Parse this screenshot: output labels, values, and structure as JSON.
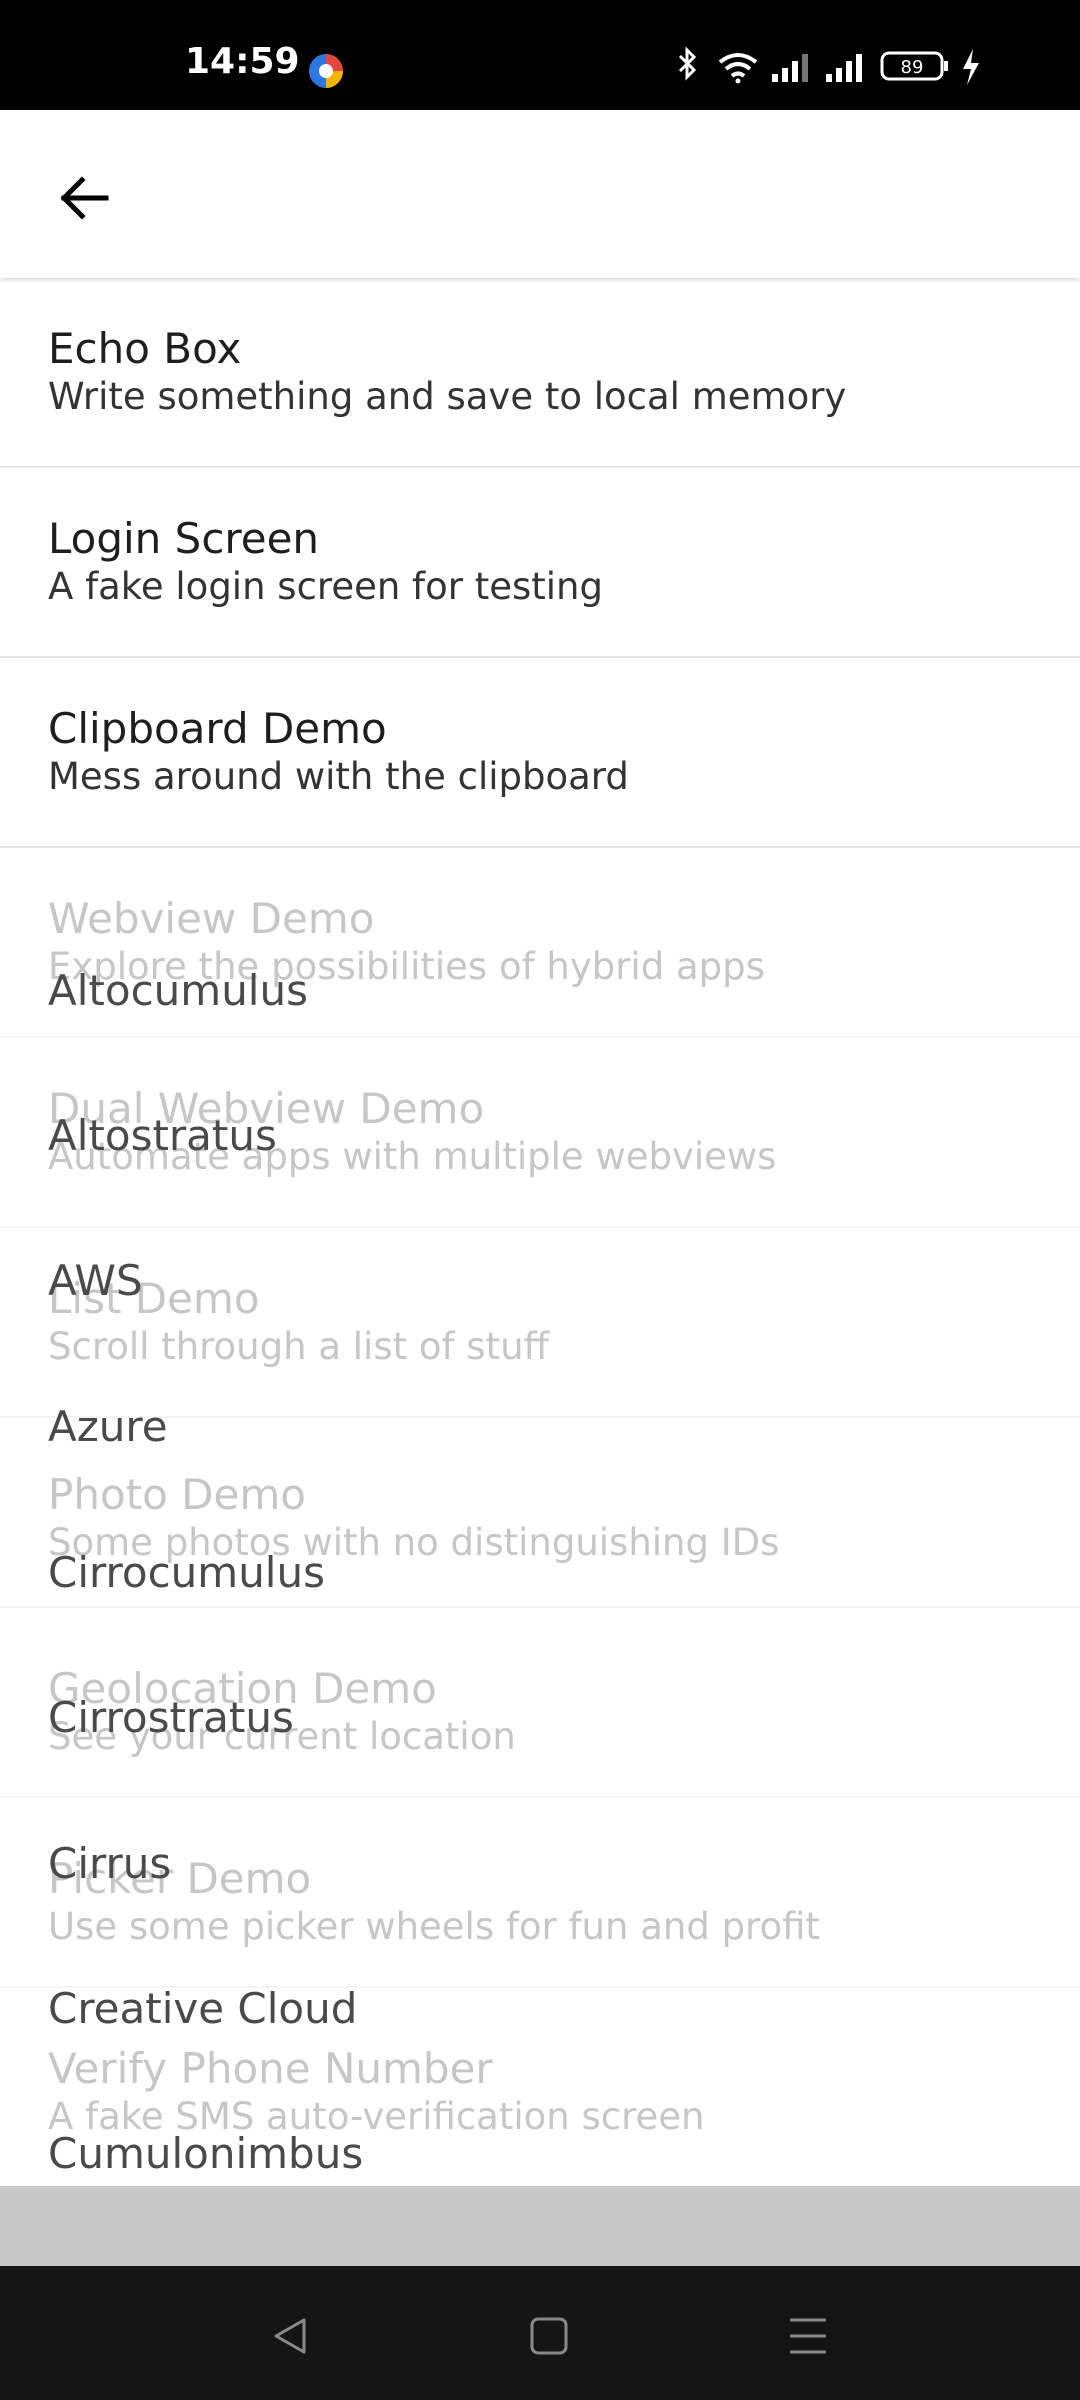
{
  "status_bar": {
    "time": "14:59",
    "battery": "89",
    "icons": [
      "bluetooth-icon",
      "wifi-icon",
      "signal-icon",
      "signal-icon",
      "battery-icon",
      "charging-icon"
    ]
  },
  "header": {
    "back_icon": "arrow-left-icon"
  },
  "list": {
    "items": [
      {
        "title": "Echo Box",
        "subtitle": "Write something and save to local memory"
      },
      {
        "title": "Login Screen",
        "subtitle": "A fake login screen for testing"
      },
      {
        "title": "Clipboard Demo",
        "subtitle": "Mess around with the clipboard"
      },
      {
        "title": "Webview Demo",
        "subtitle": "Explore the possibilities of hybrid apps"
      },
      {
        "title": "Dual Webview Demo",
        "subtitle": "Automate apps with multiple webviews"
      },
      {
        "title": "List Demo",
        "subtitle": "Scroll through a list of stuff"
      },
      {
        "title": "Photo Demo",
        "subtitle": "Some photos with no distinguishing IDs"
      },
      {
        "title": "Geolocation Demo",
        "subtitle": "See your current location"
      },
      {
        "title": "Picker Demo",
        "subtitle": "Use some picker wheels for fun and profit"
      },
      {
        "title": "Verify Phone Number",
        "subtitle": "A fake SMS auto-verification screen"
      }
    ]
  },
  "cloud_list": {
    "items": [
      "Altocumulus",
      "Altostratus",
      "AWS",
      "Azure",
      "Cirrocumulus",
      "Cirrostratus",
      "Cirrus",
      "Creative Cloud",
      "Cumulonimbus"
    ]
  },
  "nav_bar": {
    "icons": [
      "back-triangle-icon",
      "home-square-icon",
      "menu-lines-icon"
    ]
  }
}
